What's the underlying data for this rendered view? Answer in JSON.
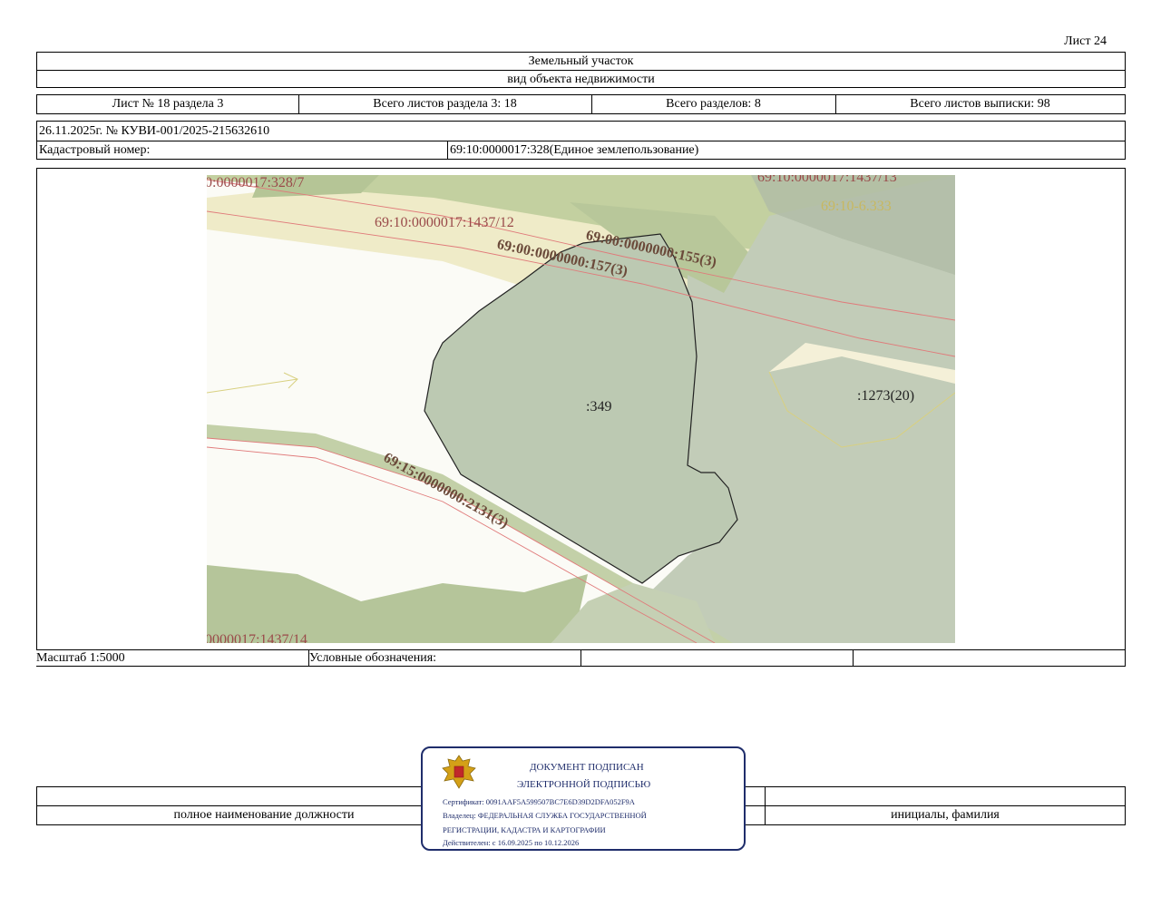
{
  "sheet_label": "Лист 24",
  "header": {
    "title": "Земельный участок",
    "subtitle": "вид объекта недвижимости"
  },
  "info_row": {
    "sheet_no": "Лист № 18 раздела 3",
    "total_sheets_section": "Всего листов раздела 3: 18",
    "total_sections": "Всего разделов: 8",
    "total_sheets_extract": "Всего листов выписки: 98"
  },
  "doc_ref": "26.11.2025г. № КУВИ-001/2025-215632610",
  "cadastral": {
    "label": "Кадастровый номер:",
    "value": "69:10:0000017:328(Единое землепользование)"
  },
  "map_labels": {
    "l1": "0:0000017:328/7",
    "l2": "69:10:0000017:1437/13",
    "l3": "69:10-6.333",
    "l4": "69:10:0000017:1437/12",
    "l5": "69:00:0000000:155(3)",
    "l6": "69:00:0000000:157(3)",
    "l7": ":349",
    "l8": ":1273(20)",
    "l9": "69:15:0000000:2131(3)",
    "l10": "0000017:1437/14"
  },
  "colors": {
    "map_green": "#bcc9b2",
    "map_olive": "#b5c596",
    "map_cream": "#efebc8",
    "red_line": "#e07a7a",
    "label_dark": "#6b4a3a",
    "label_red": "#9a4a4a",
    "stamp_blue": "#1f2d6b"
  },
  "scale": "Масштаб 1:5000",
  "legend_label": "Условные обозначения:",
  "footer": {
    "position_label": "полное наименование должности",
    "name_label": "инициалы, фамилия"
  },
  "stamp": {
    "line1": "ДОКУМЕНТ ПОДПИСАН",
    "line2": "ЭЛЕКТРОННОЙ ПОДПИСЬЮ",
    "certificate": "Сертификат: 0091AAF5A599507BC7E6D39D2DFA052F9A",
    "owner1": "Владелец: ФЕДЕРАЛЬНАЯ СЛУЖБА ГОСУДАРСТВЕННОЙ",
    "owner2": "РЕГИСТРАЦИИ, КАДАСТРА И КАРТОГРАФИИ",
    "valid": "Действителен: с 16.09.2025 по 10.12.2026",
    "emblem_icon": "coat-of-arms-icon"
  }
}
